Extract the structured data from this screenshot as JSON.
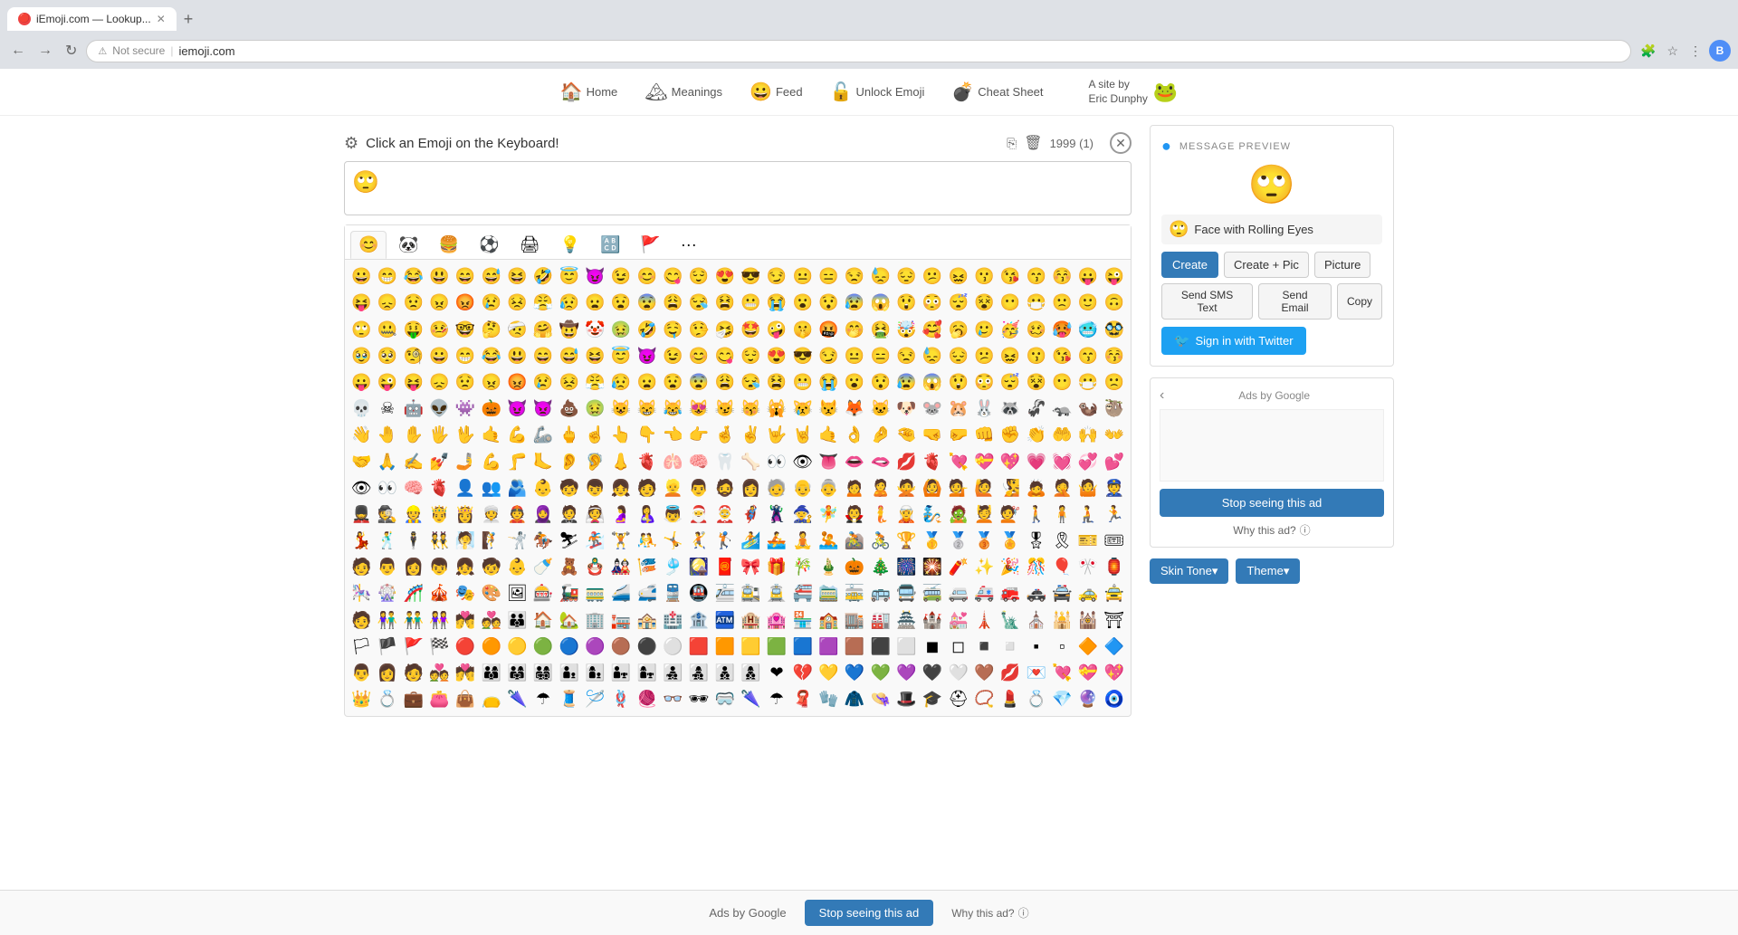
{
  "browser": {
    "tab_title": "iEmoji.com — Lookup...",
    "tab_favicon": "🔴",
    "url": "iemoji.com",
    "security_text": "Not secure",
    "new_tab_label": "+",
    "user_initial": "B"
  },
  "nav": {
    "items": [
      {
        "label": "Home",
        "emoji": "🏠"
      },
      {
        "label": "Meanings",
        "emoji": "🏔"
      },
      {
        "label": "Feed",
        "emoji": "😀"
      },
      {
        "label": "Unlock Emoji",
        "emoji": "🔓"
      },
      {
        "label": "Cheat Sheet",
        "emoji": "💣"
      }
    ],
    "site_by": "A site by\nEric Dunphy",
    "site_by_emoji": "🐸"
  },
  "main": {
    "click_header_text": "Click an Emoji on the Keyboard!",
    "counter": "1999 (1)",
    "selected_emoji": "🙄",
    "preview_emoji": "🙄",
    "emoji_name": "Face with Rolling Eyes",
    "emoji_name_icon": "🙄"
  },
  "buttons": {
    "create": "Create",
    "create_pic": "Create + Pic",
    "picture": "Picture",
    "send_sms": "Send SMS Text",
    "send_email": "Send Email",
    "copy": "Copy",
    "sign_in_twitter": "Sign in with Twitter",
    "skin_tone": "Skin Tone▾",
    "theme": "Theme▾"
  },
  "keyboard_tabs": [
    {
      "emoji": "😊",
      "label": "people"
    },
    {
      "emoji": "🐼",
      "label": "animals"
    },
    {
      "emoji": "🍔",
      "label": "food"
    },
    {
      "emoji": "⚽",
      "label": "activities"
    },
    {
      "emoji": "🖨",
      "label": "travel"
    },
    {
      "emoji": "💡",
      "label": "objects"
    },
    {
      "emoji": "🔠",
      "label": "symbols"
    },
    {
      "emoji": "🚩",
      "label": "flags"
    },
    {
      "emoji": "···",
      "label": "more"
    }
  ],
  "emojis_row1": [
    "😀",
    "😁",
    "😂",
    "😃",
    "😄",
    "😅",
    "😆",
    "🤣",
    "😇",
    "😈",
    "😉",
    "😊",
    "😋",
    "😌",
    "😍",
    "😎",
    "😏",
    "😐",
    "😑",
    "😒",
    "😓",
    "😔",
    "😕",
    "😖",
    "😗",
    "😘",
    "😙",
    "😚",
    "😛",
    "😜"
  ],
  "emojis_row2": [
    "😝",
    "😞",
    "😟",
    "😠",
    "😡",
    "😢",
    "😣",
    "😤",
    "😥",
    "😦",
    "😧",
    "😨",
    "😩",
    "😪",
    "😫",
    "😬",
    "😭",
    "😮",
    "😯",
    "😰",
    "😱",
    "😲",
    "😳",
    "😴",
    "😵",
    "😶",
    "😷",
    "🙁",
    "🙂",
    "🙃"
  ],
  "emojis_row3": [
    "🙄",
    "🤐",
    "🤑",
    "🤒",
    "🤓",
    "🤔",
    "🤕",
    "🤗",
    "🤠",
    "🤡",
    "🤢",
    "🤣",
    "🤤",
    "🤥",
    "🤧",
    "🤩",
    "🤪",
    "🤫",
    "🤬",
    "🤭",
    "🤮",
    "🤯",
    "🥰",
    "🥱",
    "🥲",
    "🥳",
    "🥴",
    "🥵",
    "🥶",
    "🥸"
  ],
  "emojis_row4": [
    "🥹",
    "🥺",
    "🧐",
    "😀",
    "😁",
    "😂",
    "😃",
    "😄",
    "😅",
    "😆",
    "😇",
    "😈",
    "😉",
    "😊",
    "😋",
    "😌",
    "😍",
    "😎",
    "😏",
    "😐",
    "😑",
    "😒",
    "😓",
    "😔",
    "😕",
    "😖",
    "😗",
    "😘",
    "😙",
    "😚"
  ],
  "emojis_row5": [
    "😛",
    "😜",
    "😝",
    "😞",
    "😟",
    "😠",
    "😡",
    "😢",
    "😣",
    "😤",
    "😥",
    "😦",
    "😧",
    "😨",
    "😩",
    "😪",
    "😫",
    "😬",
    "😭",
    "😮",
    "😯",
    "😰",
    "😱",
    "😲",
    "😳",
    "😴",
    "😵",
    "😶",
    "😷",
    "🙁"
  ],
  "emojis_row6": [
    "💀",
    "☠",
    "🤖",
    "👽",
    "👾",
    "🎃",
    "😈",
    "👿",
    "💩",
    "🤢",
    "😺",
    "😸",
    "😹",
    "😻",
    "😼",
    "😽",
    "🙀",
    "😿",
    "😾",
    "🦊",
    "🐱",
    "🐶",
    "🐭",
    "🐹",
    "🐰",
    "🦝",
    "🦨",
    "🦡",
    "🦦",
    "🦥"
  ],
  "emojis_row7": [
    "👋",
    "🤚",
    "✋",
    "🖐",
    "🖖",
    "🤙",
    "💪",
    "🦾",
    "🖕",
    "☝",
    "👆",
    "👇",
    "👈",
    "👉",
    "🤞",
    "✌",
    "🤟",
    "🤘",
    "🤙",
    "👌",
    "🤌",
    "🤏",
    "🤜",
    "🤛",
    "👊",
    "✊",
    "👏",
    "🤲",
    "🙌",
    "👐"
  ],
  "emojis_row8": [
    "🤝",
    "🙏",
    "✍",
    "💅",
    "🤳",
    "💪",
    "🦵",
    "🦶",
    "👂",
    "🦻",
    "👃",
    "🫀",
    "🫁",
    "🧠",
    "🦷",
    "🦴",
    "👀",
    "👁",
    "👅",
    "👄",
    "🫦",
    "💋",
    "🫀",
    "💘",
    "💝",
    "💖",
    "💗",
    "💓",
    "💞",
    "💕"
  ],
  "emojis_row9": [
    "👁",
    "👀",
    "🧠",
    "🫀",
    "👤",
    "👥",
    "🫂",
    "👶",
    "🧒",
    "👦",
    "👧",
    "🧑",
    "👱",
    "👨",
    "🧔",
    "👩",
    "🧓",
    "👴",
    "👵",
    "🙍",
    "🙎",
    "🙅",
    "🙆",
    "💁",
    "🙋",
    "🧏",
    "🙇",
    "🤦",
    "🤷",
    "👮"
  ],
  "emojis_row10": [
    "💂",
    "🕵",
    "👷",
    "🤴",
    "👸",
    "👳",
    "👲",
    "🧕",
    "🤵",
    "👰",
    "🤰",
    "🤱",
    "👼",
    "🎅",
    "🤶",
    "🦸",
    "🦹",
    "🧙",
    "🧚",
    "🧛",
    "🧜",
    "🧝",
    "🧞",
    "🧟",
    "💆",
    "💇",
    "🚶",
    "🧍",
    "🧎",
    "🏃"
  ],
  "emojis_row11": [
    "💃",
    "🕺",
    "🕴",
    "👯",
    "🧖",
    "🧗",
    "🤺",
    "🏇",
    "⛷",
    "🏂",
    "🏋",
    "🤼",
    "🤸",
    "🤾",
    "🏌",
    "🏄",
    "🚣",
    "🧘",
    "🤽",
    "🚵",
    "🚴",
    "🏆",
    "🥇",
    "🥈",
    "🥉",
    "🏅",
    "🎖",
    "🎗",
    "🎫",
    "🎟"
  ],
  "emojis_row12": [
    "🧑",
    "👨",
    "👩",
    "👦",
    "👧",
    "🧒",
    "👶",
    "🍼",
    "🧸",
    "🪆",
    "🎎",
    "🎏",
    "🎐",
    "🎑",
    "🧧",
    "🎀",
    "🎁",
    "🎋",
    "🎍",
    "🎃",
    "🎄",
    "🎆",
    "🎇",
    "🧨",
    "✨",
    "🎉",
    "🎊",
    "🎈",
    "🎌",
    "🏮"
  ],
  "emojis_row13": [
    "🎠",
    "🎡",
    "🎢",
    "🎪",
    "🎭",
    "🎨",
    "🖼",
    "🎰",
    "🚂",
    "🚃",
    "🚄",
    "🚅",
    "🚆",
    "🚇",
    "🚈",
    "🚉",
    "🚊",
    "🚝",
    "🚞",
    "🚋",
    "🚌",
    "🚍",
    "🚎",
    "🚐",
    "🚑",
    "🚒",
    "🚓",
    "🚔",
    "🚕",
    "🚖"
  ],
  "emojis_row14": [
    "🧑",
    "👫",
    "👬",
    "👭",
    "💏",
    "💑",
    "👪",
    "🏠",
    "🏡",
    "🏢",
    "🏣",
    "🏤",
    "🏥",
    "🏦",
    "🏧",
    "🏨",
    "🏩",
    "🏪",
    "🏫",
    "🏬",
    "🏭",
    "🏯",
    "🏰",
    "💒",
    "🗼",
    "🗽",
    "⛪",
    "🕌",
    "🕍",
    "⛩"
  ],
  "emojis_row15": [
    "🏳",
    "🏴",
    "🚩",
    "🏁",
    "🔴",
    "🟠",
    "🟡",
    "🟢",
    "🔵",
    "🟣",
    "🟤",
    "⚫",
    "⚪",
    "🟥",
    "🟧",
    "🟨",
    "🟩",
    "🟦",
    "🟪",
    "🟫",
    "⬛",
    "⬜",
    "◼",
    "◻",
    "◾",
    "◽",
    "▪",
    "▫",
    "🔶",
    "🔷"
  ],
  "emojis_row16": [
    "👨",
    "👩",
    "🧑",
    "💑",
    "💏",
    "👨‍👩‍👦",
    "👨‍👩‍👧",
    "👨‍👩‍👧‍👦",
    "👨‍👦",
    "👩‍👦",
    "👨‍👧",
    "👩‍👧",
    "👨‍👧‍👦",
    "👩‍👧‍👦",
    "👨‍👦‍👦",
    "👩‍👦‍👦",
    "❤",
    "💔",
    "💛",
    "💙",
    "💚",
    "💜",
    "🖤",
    "🤍",
    "🤎",
    "💋",
    "💌",
    "💘",
    "💝",
    "💖"
  ],
  "emojis_row17": [
    "👑",
    "💍",
    "💼",
    "👛",
    "👜",
    "👝",
    "🌂",
    "☂",
    "🧵",
    "🪡",
    "🪢",
    "🧶",
    "👓",
    "🕶",
    "🥽",
    "🌂",
    "☂",
    "🧣",
    "🧤",
    "🧥",
    "👒",
    "🎩",
    "🎓",
    "⛑",
    "📿",
    "💄",
    "💍",
    "💎",
    "🔮",
    "🧿"
  ],
  "ads": {
    "ads_by_google": "Ads by Google",
    "stop_seeing_label": "Stop seeing this ad",
    "why_this_ad": "Why this ad?",
    "info_icon": "ⓘ"
  },
  "bottom_ad": {
    "label": "Ads by Google",
    "stop_btn": "Stop seeing this ad",
    "why_btn": "Why this ad?",
    "info_icon": "ⓘ"
  },
  "message_preview": {
    "label": "MESSAGE PREVIEW"
  }
}
